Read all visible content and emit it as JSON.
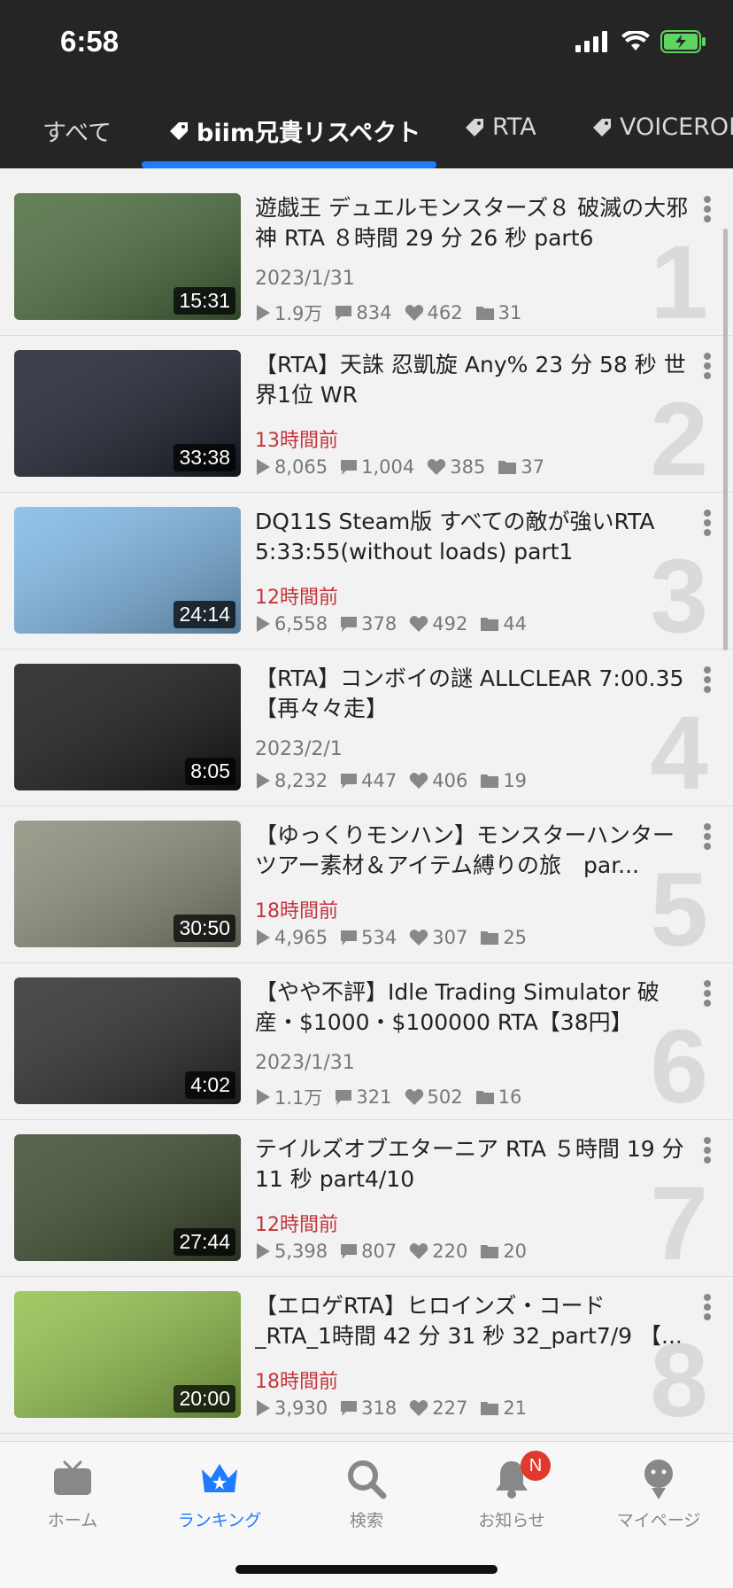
{
  "status_bar": {
    "time": "6:58"
  },
  "tabs": [
    {
      "label": "すべて",
      "has_tag_icon": false
    },
    {
      "label": "biim兄貴リスペクト",
      "has_tag_icon": true
    },
    {
      "label": "RTA",
      "has_tag_icon": true
    },
    {
      "label": "VOICEROI",
      "has_tag_icon": true
    }
  ],
  "active_tab": "biim兄貴リスペクト",
  "videos": [
    {
      "rank": "1",
      "title": "遊戯王 デュエルモンスターズ８ 破滅の大邪神 RTA ８時間 29 分 26 秒 part6",
      "date": "2023/1/31",
      "recent": false,
      "views": "1.9万",
      "comments": "834",
      "likes": "462",
      "mylists": "31",
      "duration": "15:31",
      "thumb_color": "#4a6b3c"
    },
    {
      "rank": "2",
      "title": "【RTA】天誅 忍凱旋 Any% 23 分 58 秒 世界1位 WR",
      "date": "13時間前",
      "recent": true,
      "views": "8,065",
      "comments": "1,004",
      "likes": "385",
      "mylists": "37",
      "duration": "33:38",
      "thumb_color": "#1a1f2c"
    },
    {
      "rank": "3",
      "title": "DQ11S Steam版 すべての敵が強いRTA 5:33:55(without loads) part1",
      "date": "12時間前",
      "recent": true,
      "views": "6,558",
      "comments": "378",
      "likes": "492",
      "mylists": "44",
      "duration": "24:14",
      "thumb_color": "#7fb8e6"
    },
    {
      "rank": "4",
      "title": "【RTA】コンボイの謎 ALLCLEAR 7:00.35【再々々走】",
      "date": "2023/2/1",
      "recent": false,
      "views": "8,232",
      "comments": "447",
      "likes": "406",
      "mylists": "19",
      "duration": "8:05",
      "thumb_color": "#161616"
    },
    {
      "rank": "5",
      "title": "【ゆっくりモンハン】モンスターハンターツアー素材＆アイテム縛りの旅　par...",
      "date": "18時間前",
      "recent": true,
      "views": "4,965",
      "comments": "534",
      "likes": "307",
      "mylists": "25",
      "duration": "30:50",
      "thumb_color": "#8c8c7a"
    },
    {
      "rank": "6",
      "title": "【やや不評】Idle Trading Simulator 破産・$1000・$100000 RTA【38円】",
      "date": "2023/1/31",
      "recent": false,
      "views": "1.1万",
      "comments": "321",
      "likes": "502",
      "mylists": "16",
      "duration": "4:02",
      "thumb_color": "#2a2a2a"
    },
    {
      "rank": "7",
      "title": "テイルズオブエターニア RTA ５時間 19 分 11 秒 part4/10",
      "date": "12時間前",
      "recent": true,
      "views": "5,398",
      "comments": "807",
      "likes": "220",
      "mylists": "20",
      "duration": "27:44",
      "thumb_color": "#3a4a2c"
    },
    {
      "rank": "8",
      "title": "【エロゲRTA】ヒロインズ・コード _RTA_1時間 42 分 31 秒 32_part7/9 【...",
      "date": "18時間前",
      "recent": true,
      "views": "3,930",
      "comments": "318",
      "likes": "227",
      "mylists": "21",
      "duration": "20:00",
      "thumb_color": "#8fbf4a"
    }
  ],
  "bottom_nav": [
    {
      "label": "ホーム",
      "icon": "tv-icon",
      "active": false
    },
    {
      "label": "ランキング",
      "icon": "crown-icon",
      "active": true
    },
    {
      "label": "検索",
      "icon": "search-icon",
      "active": false
    },
    {
      "label": "お知らせ",
      "icon": "bell-icon",
      "active": false,
      "badge": "N"
    },
    {
      "label": "マイページ",
      "icon": "user-icon",
      "active": false
    }
  ],
  "colors": {
    "accent": "#1f7bff",
    "recent_date": "#c5343d",
    "header_bg": "#252525",
    "badge": "#e0392f"
  }
}
